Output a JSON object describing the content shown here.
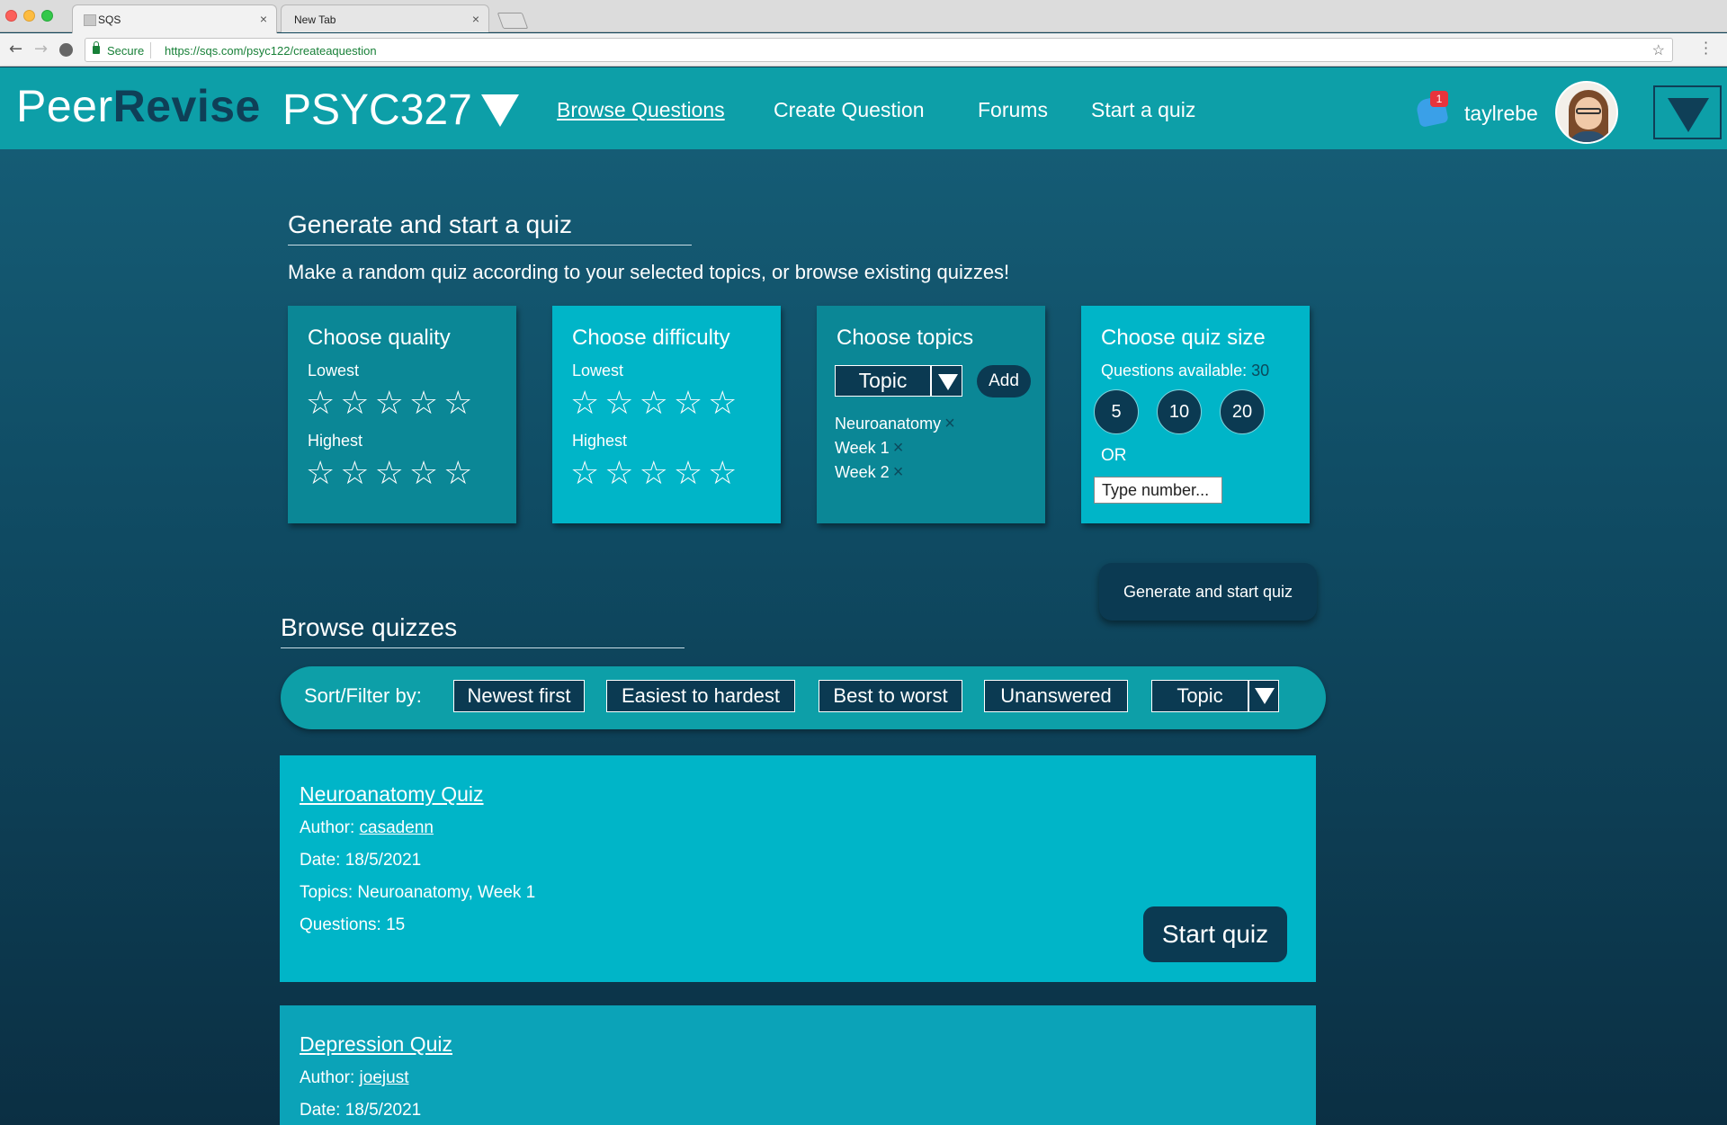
{
  "browser": {
    "tabs": [
      {
        "label": "SQS"
      },
      {
        "label": "New Tab"
      }
    ],
    "secure_label": "Secure",
    "url": "https://sqs.com/psyc122/createaquestion"
  },
  "header": {
    "logo_light": "Peer",
    "logo_strong": "Revise",
    "course": "PSYC327",
    "nav": {
      "browse": "Browse Questions",
      "create": "Create Question",
      "forums": "Forums",
      "quiz": "Start a quiz"
    },
    "notification_count": "1",
    "username": "taylrebe"
  },
  "generate": {
    "title": "Generate and start a quiz",
    "subtitle": "Make a random quiz according to your selected topics, or browse existing quizzes!",
    "quality": {
      "title": "Choose quality",
      "lowest_label": "Lowest",
      "highest_label": "Highest",
      "lowest_rating": 0,
      "highest_rating": 0
    },
    "difficulty": {
      "title": "Choose difficulty",
      "lowest_label": "Lowest",
      "highest_label": "Highest",
      "lowest_rating": 0,
      "highest_rating": 0
    },
    "topics": {
      "title": "Choose topics",
      "select_label": "Topic",
      "add_label": "Add",
      "selected": [
        "Neuroanatomy",
        "Week 1",
        "Week 2"
      ]
    },
    "size": {
      "title": "Choose quiz size",
      "available_label": "Questions available:",
      "available_value": "30",
      "options": [
        "5",
        "10",
        "20"
      ],
      "or_label": "OR",
      "input_placeholder": "Type number..."
    },
    "button_label": "Generate and start quiz"
  },
  "browse": {
    "title": "Browse quizzes",
    "filter_label": "Sort/Filter by:",
    "filters": {
      "newest": "Newest first",
      "easiest": "Easiest to hardest",
      "best": "Best to worst",
      "unanswered": "Unanswered",
      "topic": "Topic"
    },
    "quizzes": [
      {
        "title": "Neuroanatomy Quiz",
        "author_label": "Author:",
        "author": "casadenn",
        "date": "Date: 18/5/2021",
        "topics": "Topics: Neuroanatomy, Week 1",
        "questions": "Questions: 15",
        "start_label": "Start quiz"
      },
      {
        "title": "Depression Quiz",
        "author_label": "Author:",
        "author": "joejust",
        "date": "Date: 18/5/2021"
      }
    ]
  }
}
